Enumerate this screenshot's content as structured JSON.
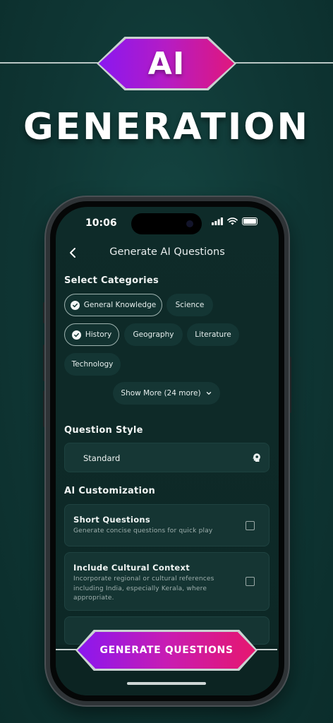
{
  "promo": {
    "badge_text": "AI",
    "headline": "GENERATION"
  },
  "status_bar": {
    "time": "10:06"
  },
  "nav": {
    "title": "Generate AI Questions"
  },
  "categories": {
    "heading": "Select Categories",
    "items": [
      {
        "label": "General Knowledge",
        "selected": true
      },
      {
        "label": "Science",
        "selected": false
      },
      {
        "label": "History",
        "selected": true
      },
      {
        "label": "Geography",
        "selected": false
      },
      {
        "label": "Literature",
        "selected": false
      },
      {
        "label": "Technology",
        "selected": false
      }
    ],
    "show_more": "Show More (24 more)"
  },
  "question_style": {
    "heading": "Question Style",
    "value": "Standard"
  },
  "ai_customization": {
    "heading": "AI Customization",
    "options": [
      {
        "title": "Short Questions",
        "description": "Generate concise questions for quick play",
        "checked": false
      },
      {
        "title": "Include Cultural Context",
        "description": "Incorporate regional or cultural references including India, especially Kerala, where appropriate.",
        "checked": false
      }
    ]
  },
  "generate_button": {
    "label": "GENERATE QUESTIONS"
  },
  "colors": {
    "background": "#0f3634",
    "gradient_start": "#8a17f0",
    "gradient_mid": "#c81cb3",
    "gradient_end": "#e6176f"
  }
}
